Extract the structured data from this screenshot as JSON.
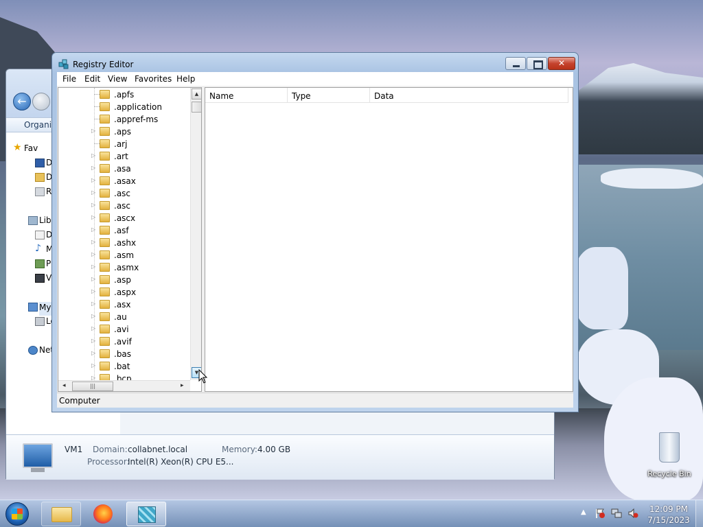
{
  "desktop": {
    "recycle_bin_label": "Recycle Bin"
  },
  "explorer": {
    "command_label": "Organiz",
    "sidebar": [
      {
        "label": "Fav",
        "icon": "star-icon"
      },
      {
        "label": "D",
        "icon": "desktop-icon"
      },
      {
        "label": "D",
        "icon": "downloads-icon"
      },
      {
        "label": "R",
        "icon": "recent-places-icon"
      },
      {
        "label": "Libr",
        "icon": "libraries-icon"
      },
      {
        "label": "D",
        "icon": "documents-icon"
      },
      {
        "label": "M",
        "icon": "music-icon"
      },
      {
        "label": "P",
        "icon": "pictures-icon"
      },
      {
        "label": "V",
        "icon": "videos-icon"
      },
      {
        "label": "My",
        "icon": "computer-icon"
      },
      {
        "label": "Lo",
        "icon": "local-disk-icon"
      },
      {
        "label": "Net",
        "icon": "network-icon"
      }
    ],
    "details": {
      "computer_name": "VM1",
      "domain_label": "Domain:",
      "domain_value": "collabnet.local",
      "memory_label": "Memory:",
      "memory_value": "4.00 GB",
      "processor_label": "Processor:",
      "processor_value": "Intel(R) Xeon(R) CPU E5..."
    }
  },
  "regedit": {
    "title": "Registry Editor",
    "close_glyph": "✕",
    "menu": [
      "File",
      "Edit",
      "View",
      "Favorites",
      "Help"
    ],
    "tree_items": [
      {
        "label": ".apfs",
        "expandable": false
      },
      {
        "label": ".application",
        "expandable": false
      },
      {
        "label": ".appref-ms",
        "expandable": false
      },
      {
        "label": ".aps",
        "expandable": true
      },
      {
        "label": ".arj",
        "expandable": false
      },
      {
        "label": ".art",
        "expandable": true
      },
      {
        "label": ".asa",
        "expandable": true
      },
      {
        "label": ".asax",
        "expandable": true
      },
      {
        "label": ".asc",
        "expandable": true
      },
      {
        "label": ".asc",
        "expandable": true
      },
      {
        "label": ".ascx",
        "expandable": true
      },
      {
        "label": ".asf",
        "expandable": true
      },
      {
        "label": ".ashx",
        "expandable": true
      },
      {
        "label": ".asm",
        "expandable": true
      },
      {
        "label": ".asmx",
        "expandable": true
      },
      {
        "label": ".asp",
        "expandable": true
      },
      {
        "label": ".aspx",
        "expandable": true
      },
      {
        "label": ".asx",
        "expandable": true
      },
      {
        "label": ".au",
        "expandable": true
      },
      {
        "label": ".avi",
        "expandable": true
      },
      {
        "label": ".avif",
        "expandable": true
      },
      {
        "label": ".bas",
        "expandable": true
      },
      {
        "label": ".bat",
        "expandable": true
      },
      {
        "label": ".bcp",
        "expandable": true
      }
    ],
    "columns": [
      "Name",
      "Type",
      "Data"
    ],
    "status": "Computer"
  },
  "taskbar": {
    "time": "12:09 PM",
    "date": "7/15/2023"
  }
}
